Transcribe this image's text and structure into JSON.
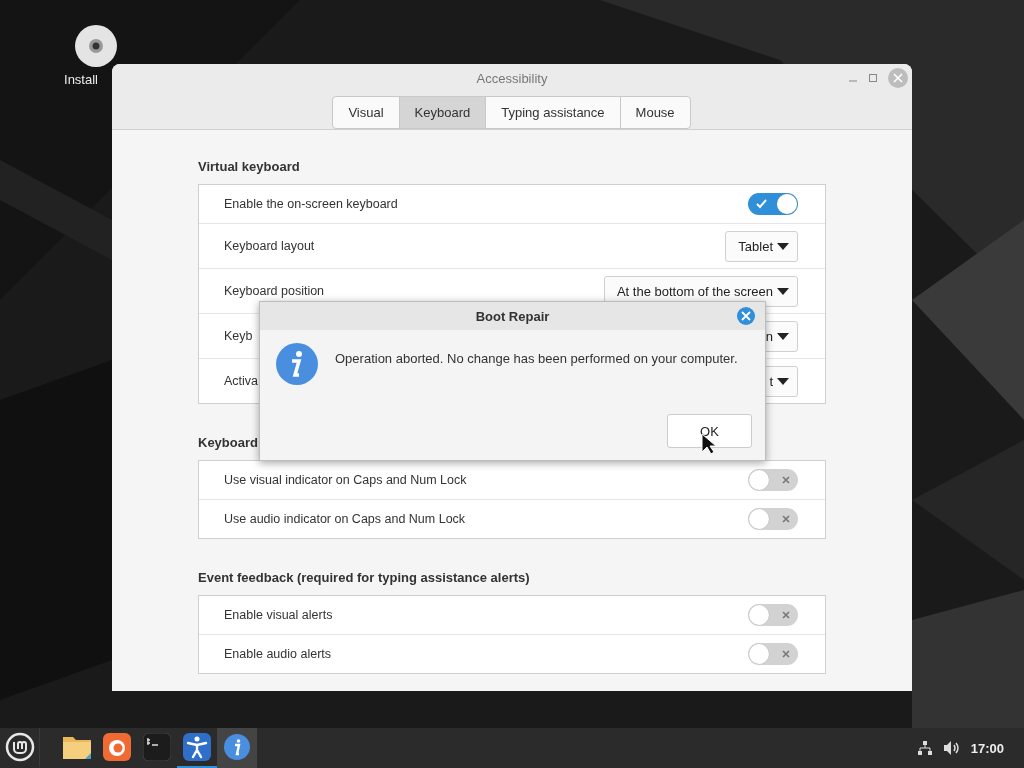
{
  "desktop_icons": [
    {
      "label": "Install",
      "kind": "disc"
    }
  ],
  "window": {
    "title": "Accessibility",
    "tabs": [
      {
        "label": "Visual",
        "selected": false
      },
      {
        "label": "Keyboard",
        "selected": true
      },
      {
        "label": "Typing assistance",
        "selected": false
      },
      {
        "label": "Mouse",
        "selected": false
      }
    ],
    "sections": [
      {
        "title": "Virtual keyboard",
        "rows": [
          {
            "label": "Enable the on-screen keyboard",
            "kind": "switch",
            "on": true
          },
          {
            "label": "Keyboard layout",
            "kind": "dropdown",
            "value": "Tablet"
          },
          {
            "label": "Keyboard position",
            "kind": "dropdown",
            "value": "At the bottom of the screen"
          },
          {
            "label": "Keyb",
            "kind": "dropdown",
            "value": "n"
          },
          {
            "label": "Activa",
            "kind": "dropdown",
            "value": "t"
          }
        ]
      },
      {
        "title": "Keyboard",
        "rows": [
          {
            "label": "Use visual indicator on Caps and Num Lock",
            "kind": "switch",
            "on": false
          },
          {
            "label": "Use audio indicator on Caps and Num Lock",
            "kind": "switch",
            "on": false
          }
        ]
      },
      {
        "title": "Event feedback (required for typing assistance alerts)",
        "rows": [
          {
            "label": "Enable visual alerts",
            "kind": "switch",
            "on": false
          },
          {
            "label": "Enable audio alerts",
            "kind": "switch",
            "on": false
          }
        ]
      }
    ]
  },
  "dialog": {
    "title": "Boot Repair",
    "message": "Operation aborted. No change has been performed on your computer.",
    "button": "OK"
  },
  "taskbar": {
    "items": [
      {
        "kind": "menu",
        "selected": false,
        "running": false
      },
      {
        "kind": "files",
        "selected": false,
        "running": false
      },
      {
        "kind": "browser",
        "selected": false,
        "running": false
      },
      {
        "kind": "terminal",
        "selected": false,
        "running": false
      },
      {
        "kind": "accessibility",
        "selected": false,
        "running": true
      },
      {
        "kind": "info",
        "selected": true,
        "running": false
      }
    ],
    "clock": "17:00"
  }
}
